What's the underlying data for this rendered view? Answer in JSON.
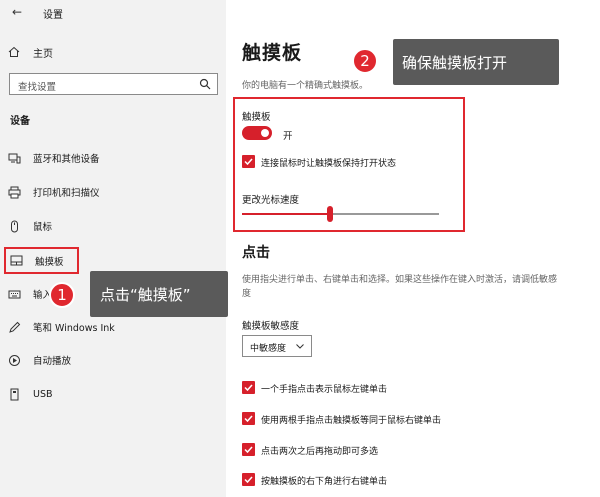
{
  "app": {
    "title": "设置",
    "back_icon": "back-arrow-icon"
  },
  "sidebar": {
    "home_label": "主页",
    "search_placeholder": "查找设置",
    "section": "设备",
    "items": [
      {
        "label": "蓝牙和其他设备",
        "icon": "bluetooth-devices-icon"
      },
      {
        "label": "打印机和扫描仪",
        "icon": "printer-icon"
      },
      {
        "label": "鼠标",
        "icon": "mouse-icon"
      },
      {
        "label": "触摸板",
        "icon": "touchpad-icon",
        "active": true
      },
      {
        "label": "输入",
        "icon": "keyboard-icon"
      },
      {
        "label": "笔和 Windows Ink",
        "icon": "pen-icon"
      },
      {
        "label": "自动播放",
        "icon": "autoplay-icon"
      },
      {
        "label": "USB",
        "icon": "usb-icon"
      }
    ]
  },
  "main": {
    "title": "触摸板",
    "subtitle": "你的电脑有一个精确式触摸板。",
    "touchpad_label": "触摸板",
    "toggle_state": "开",
    "toggle_on": true,
    "keep_on_label": "连接鼠标时让触摸板保持打开状态",
    "keep_on_checked": true,
    "speed_label": "更改光标速度",
    "speed_value": 0.44,
    "click_heading": "点击",
    "click_desc": "使用指尖进行单击、右键单击和选择。如果这些操作在键入时激活，请调低敏感度",
    "sensitivity_label": "触摸板敏感度",
    "sensitivity_value": "中敏感度",
    "options": [
      {
        "label": "一个手指点击表示鼠标左键单击",
        "checked": true
      },
      {
        "label": "使用两根手指点击触摸板等同于鼠标右键单击",
        "checked": true
      },
      {
        "label": "点击两次之后再拖动即可多选",
        "checked": true
      },
      {
        "label": "按触摸板的右下角进行右键单击",
        "checked": true
      }
    ]
  },
  "callouts": {
    "step1_num": "1",
    "step1_text": "点击“触摸板”",
    "step2_num": "2",
    "step2_text": "确保触摸板打开"
  },
  "colors": {
    "accent": "#d6202b",
    "highlight": "#e0282f",
    "sidebar_bg": "#f2f2f2",
    "callout_bg": "#5a5a5a"
  }
}
